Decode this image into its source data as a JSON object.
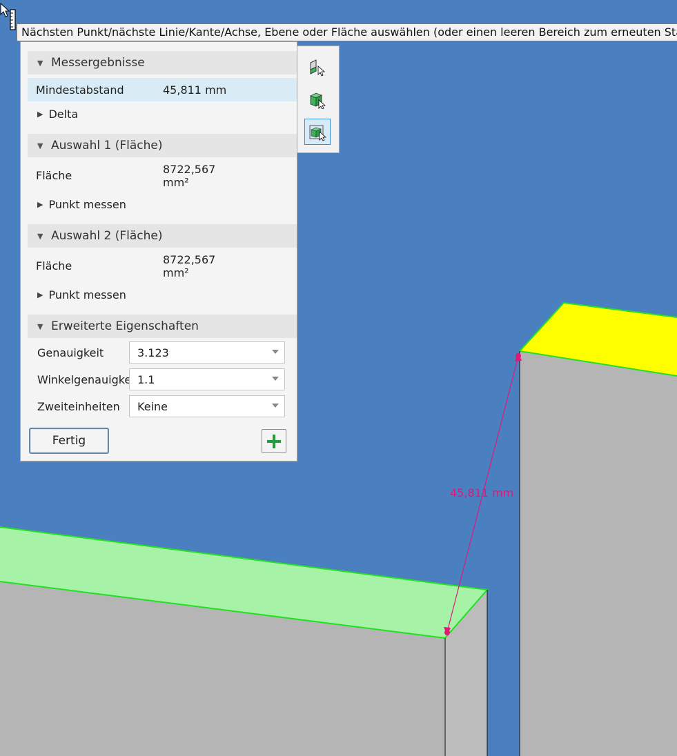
{
  "tooltip": {
    "text": "Nächsten Punkt/nächste Linie/Kante/Achse, Ebene oder Fläche auswählen (oder einen leeren Bereich zum erneuten Starten"
  },
  "results": {
    "header": "Messergebnisse",
    "min_distance_label": "Mindestabstand",
    "min_distance_value": "45,811 mm",
    "delta_label": "Delta"
  },
  "selection1": {
    "header": "Auswahl 1 (Fläche)",
    "area_label": "Fläche",
    "area_value_line1": "8722,567",
    "area_value_line2": "mm²",
    "measure_point_label": "Punkt messen"
  },
  "selection2": {
    "header": "Auswahl 2 (Fläche)",
    "area_label": "Fläche",
    "area_value_line1": "8722,567",
    "area_value_line2": "mm²",
    "measure_point_label": "Punkt messen"
  },
  "advanced": {
    "header": "Erweiterte Eigenschaften",
    "precision_label": "Genauigkeit",
    "precision_value": "3.123",
    "angular_precision_label": "Winkelgenauigkeit",
    "angular_precision_value": "1.1",
    "dual_units_label": "Zweiteinheiten",
    "dual_units_value": "Keine"
  },
  "buttons": {
    "done_label": "Fertig"
  },
  "viewport": {
    "dimension_label": "45,811 mm",
    "colors": {
      "background": "#4a7fc0",
      "selected_face_1": "#a6f2a6",
      "selected_face_2": "#ffff00",
      "body_side": "#b5b5b5",
      "edge_highlight": "#22e022",
      "dimension": "#e0187a"
    }
  },
  "selection_toolbar": {
    "icons": [
      "select-edge-icon",
      "select-face-icon",
      "select-body-icon"
    ],
    "active_index": 2
  }
}
